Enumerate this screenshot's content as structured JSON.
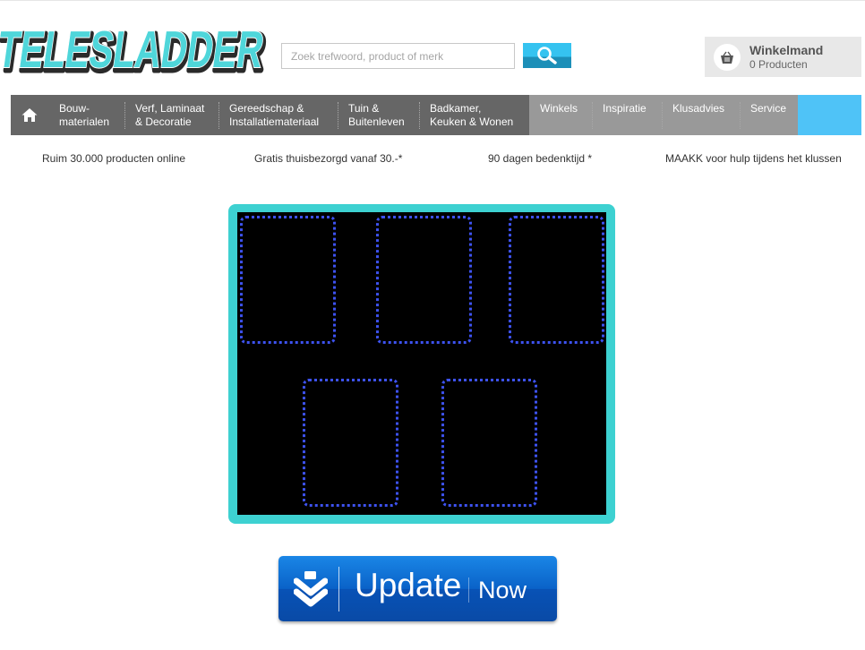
{
  "logo": {
    "text": "TELESLADDER"
  },
  "search": {
    "placeholder": "Zoek trefwoord, product of merk",
    "button_icon": "magnifier-icon"
  },
  "cart": {
    "title": "Winkelmand",
    "count": "0 Producten",
    "icon": "basket-icon"
  },
  "nav": {
    "home_icon": "home-icon",
    "items": [
      {
        "line1": "Bouw-",
        "line2": "materialen"
      },
      {
        "line1": "Verf, Laminaat",
        "line2": "& Decoratie"
      },
      {
        "line1": "Gereedschap &",
        "line2": "Installatiemateriaal"
      },
      {
        "line1": "Tuin &",
        "line2": "Buitenleven"
      },
      {
        "line1": "Badkamer,",
        "line2": "Keuken & Wonen"
      }
    ],
    "secondary": [
      {
        "label": "Winkels"
      },
      {
        "label": "Inspiratie"
      },
      {
        "label": "Klusadvies"
      },
      {
        "label": "Service"
      }
    ]
  },
  "usps": [
    "Ruim 30.000 producten online",
    "Gratis thuisbezorgd vanaf 30.-*",
    "90 dagen bedenktijd *",
    "MAAKK voor hulp tijdens het klussen"
  ],
  "update_button": {
    "label": "Update",
    "label2": "Now",
    "icon": "download-chevrons-icon"
  },
  "colors": {
    "accent_cyan": "#3dd1d1",
    "nav_dark": "#666666",
    "nav_light": "#999999",
    "nav_fill": "#4fc3f7",
    "update_blue": "#0a62c8",
    "slot_border": "#3d52f0"
  }
}
